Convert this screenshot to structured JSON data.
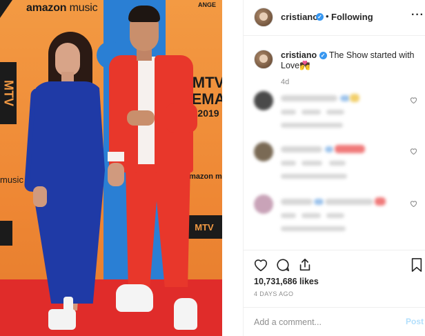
{
  "photo": {
    "logo_amazon_top_a": "amazon",
    "logo_amazon_top_b": " music",
    "logo_music_left": "music",
    "logo_amazon_right": "amazon music",
    "mtv_right_top": "MTV",
    "mtv_right_mid": "EMA",
    "mtv_right_bot": "2019",
    "ange_text": "ANGE",
    "mtv_small": "MTV"
  },
  "header": {
    "username": "cristiano",
    "separator": "•",
    "follow_status": "Following",
    "more_label": "···"
  },
  "caption": {
    "username": "cristiano",
    "text": "The Show started with Love💏",
    "time_ago": "4d"
  },
  "comments": [
    {
      "avatar_color": "#4a4a4a"
    },
    {
      "avatar_color": "#7a6a55"
    },
    {
      "avatar_color": "#c9a3b8"
    }
  ],
  "actions": {
    "likes": "10,731,686 likes",
    "post_date": "4 DAYS AGO"
  },
  "add_comment": {
    "placeholder": "Add a comment...",
    "post_label": "Post"
  },
  "colors": {
    "verified": "#3897f0",
    "post_button": "#b2dffc",
    "muted": "#8e8e8e"
  }
}
